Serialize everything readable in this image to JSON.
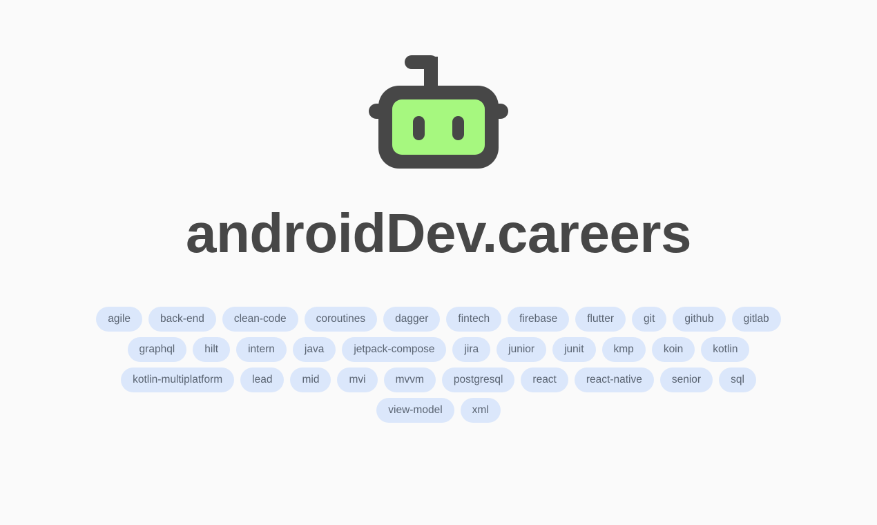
{
  "page": {
    "background_color": "#fafafa"
  },
  "logo": {
    "icon_name": "robot-icon",
    "frame_color": "#474747",
    "face_color": "#a6f87f"
  },
  "header": {
    "title": "androidDev.careers",
    "title_color": "#474747"
  },
  "tags": {
    "chip_background_color": "#dbe7fb",
    "chip_text_color": "#5a6472",
    "items": [
      "agile",
      "back-end",
      "clean-code",
      "coroutines",
      "dagger",
      "fintech",
      "firebase",
      "flutter",
      "git",
      "github",
      "gitlab",
      "graphql",
      "hilt",
      "intern",
      "java",
      "jetpack-compose",
      "jira",
      "junior",
      "junit",
      "kmp",
      "koin",
      "kotlin",
      "kotlin-multiplatform",
      "lead",
      "mid",
      "mvi",
      "mvvm",
      "postgresql",
      "react",
      "react-native",
      "senior",
      "sql",
      "view-model",
      "xml"
    ]
  }
}
